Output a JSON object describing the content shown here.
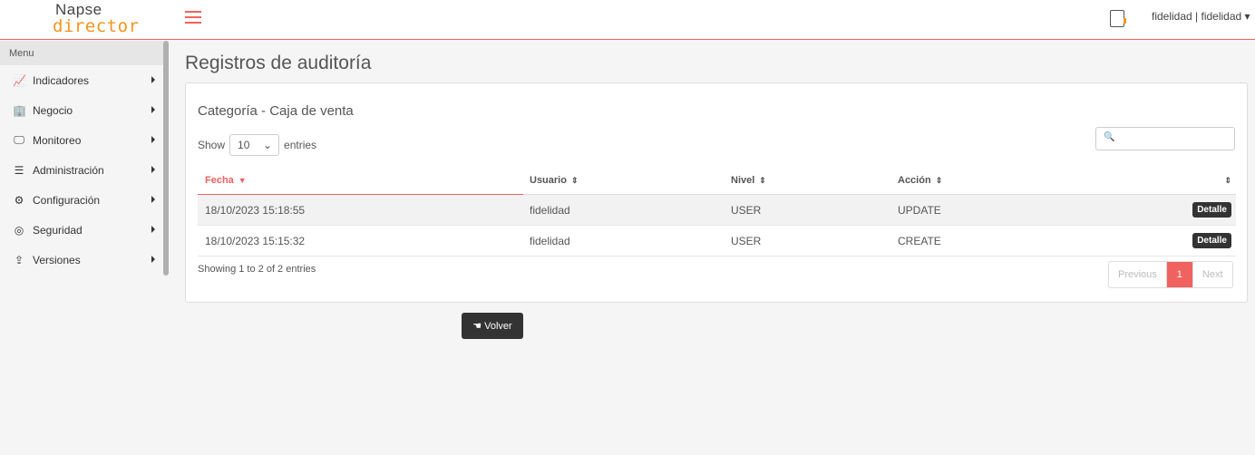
{
  "header": {
    "logo_line1": "Napse",
    "logo_line2": "director",
    "user_menu": "fidelidad | fidelidad ▾",
    "accent_color": "#f0625f",
    "brand_orange": "#f7941d"
  },
  "sidebar": {
    "menu_label": "Menu",
    "items": [
      {
        "label": "Indicadores",
        "icon": "chart-line-icon",
        "glyph": "📈"
      },
      {
        "label": "Negocio",
        "icon": "building-icon",
        "glyph": "🏢"
      },
      {
        "label": "Monitoreo",
        "icon": "monitor-icon",
        "glyph": "🖵"
      },
      {
        "label": "Administración",
        "icon": "list-icon",
        "glyph": "☰"
      },
      {
        "label": "Configuración",
        "icon": "gears-icon",
        "glyph": "⚙"
      },
      {
        "label": "Seguridad",
        "icon": "fingerprint-icon",
        "glyph": "◎"
      },
      {
        "label": "Versiones",
        "icon": "upload-icon",
        "glyph": "⇪"
      }
    ]
  },
  "page": {
    "title": "Registros de auditoría"
  },
  "card": {
    "title": "Categoría - Caja de venta",
    "length_prefix": "Show",
    "length_value": "10",
    "length_suffix": "entries",
    "search_placeholder": "🔍",
    "columns": [
      "Fecha",
      "Usuario",
      "Nivel",
      "Acción",
      ""
    ],
    "sort_column": "Fecha",
    "rows": [
      {
        "fecha": "18/10/2023 15:18:55",
        "usuario": "fidelidad",
        "nivel": "USER",
        "accion": "UPDATE",
        "button": "Detalle"
      },
      {
        "fecha": "18/10/2023 15:15:32",
        "usuario": "fidelidad",
        "nivel": "USER",
        "accion": "CREATE",
        "button": "Detalle"
      }
    ],
    "info": "Showing 1 to 2 of 2 entries",
    "pagination": {
      "previous": "Previous",
      "current": "1",
      "next": "Next"
    }
  },
  "actions": {
    "back_label": "Volver"
  }
}
